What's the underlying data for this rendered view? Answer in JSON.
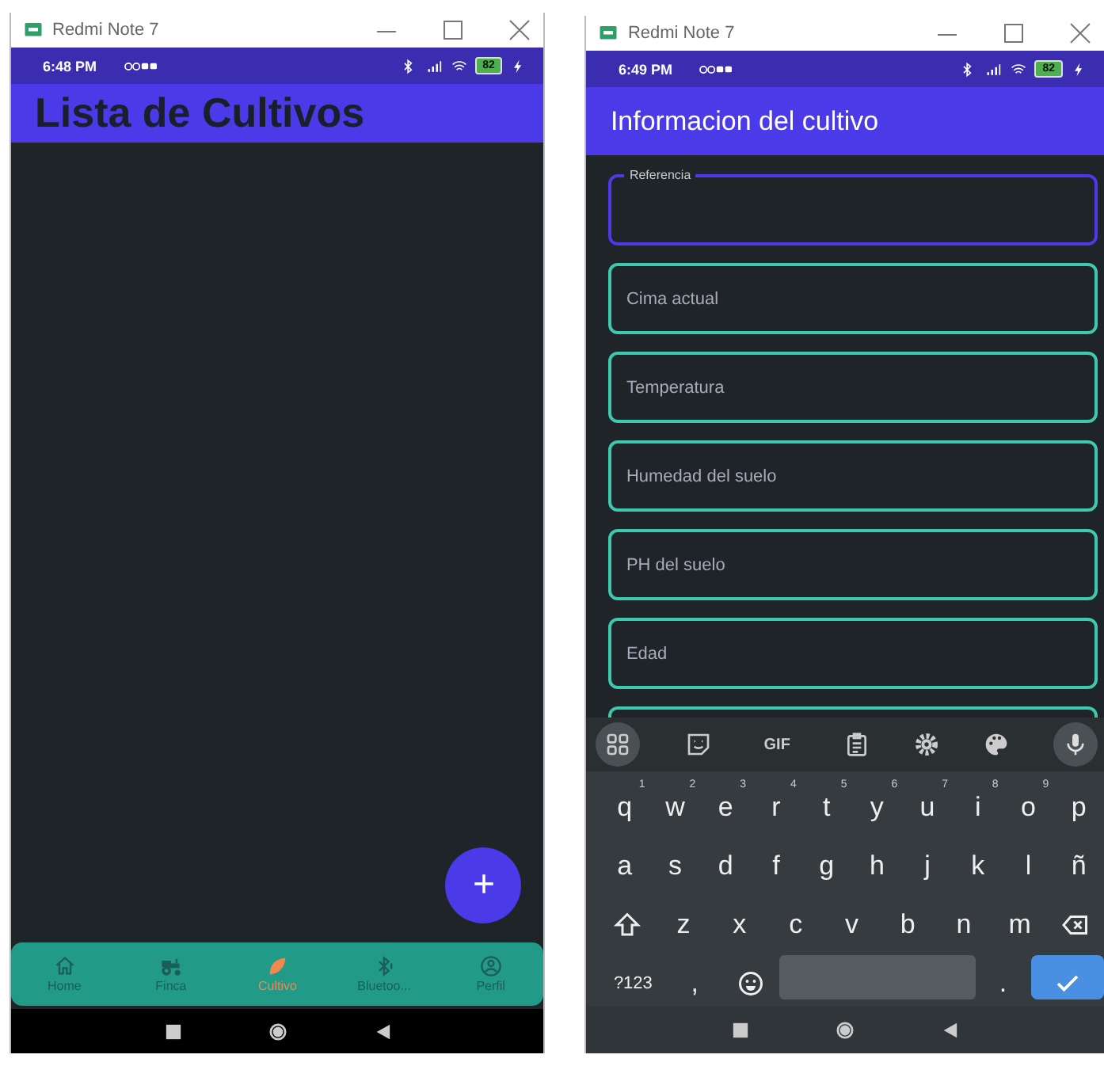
{
  "windows": [
    {
      "title": "Redmi Note 7",
      "status": {
        "time": "6:48 PM",
        "battery": "82"
      },
      "app_bar": {
        "title": "Lista de Cultivos"
      },
      "fab": {
        "label": "+"
      },
      "bottom_nav": [
        {
          "label": "Home",
          "selected": false
        },
        {
          "label": "Finca",
          "selected": false
        },
        {
          "label": "Cultivo",
          "selected": true
        },
        {
          "label": "Bluetoo...",
          "selected": false
        },
        {
          "label": "Perfil",
          "selected": false
        }
      ]
    },
    {
      "title": "Redmi Note 7",
      "status": {
        "time": "6:49 PM",
        "battery": "82"
      },
      "app_bar": {
        "title": "Informacion del cultivo"
      },
      "fields": [
        {
          "label": "Referencia",
          "focused": true
        },
        {
          "label": "Cima actual",
          "focused": false
        },
        {
          "label": "Temperatura",
          "focused": false
        },
        {
          "label": "Humedad del suelo",
          "focused": false
        },
        {
          "label": "PH del suelo",
          "focused": false
        },
        {
          "label": "Edad",
          "focused": false
        }
      ],
      "keyboard": {
        "toolbar": [
          {
            "kind": "text",
            "label": "GIF"
          }
        ],
        "rows": [
          [
            {
              "label": "q",
              "hint": "1"
            },
            {
              "label": "w",
              "hint": "2"
            },
            {
              "label": "e",
              "hint": "3"
            },
            {
              "label": "r",
              "hint": "4"
            },
            {
              "label": "t",
              "hint": "5"
            },
            {
              "label": "y",
              "hint": "6"
            },
            {
              "label": "u",
              "hint": "7"
            },
            {
              "label": "i",
              "hint": "8"
            },
            {
              "label": "o",
              "hint": "9"
            },
            {
              "label": "p"
            }
          ],
          [
            {
              "label": "a"
            },
            {
              "label": "s"
            },
            {
              "label": "d"
            },
            {
              "label": "f"
            },
            {
              "label": "g"
            },
            {
              "label": "h"
            },
            {
              "label": "j"
            },
            {
              "label": "k"
            },
            {
              "label": "l"
            },
            {
              "label": "ñ"
            }
          ],
          [
            {
              "kind": "shift"
            },
            {
              "label": "z"
            },
            {
              "label": "x"
            },
            {
              "label": "c"
            },
            {
              "label": "v"
            },
            {
              "label": "b"
            },
            {
              "label": "n"
            },
            {
              "label": "m"
            },
            {
              "kind": "backspace"
            }
          ],
          [
            {
              "label": "?123",
              "kind": "mode"
            },
            {
              "label": ","
            },
            {
              "kind": "emoji"
            },
            {
              "kind": "space"
            },
            {
              "label": "."
            },
            {
              "kind": "enter"
            }
          ]
        ]
      }
    }
  ]
}
